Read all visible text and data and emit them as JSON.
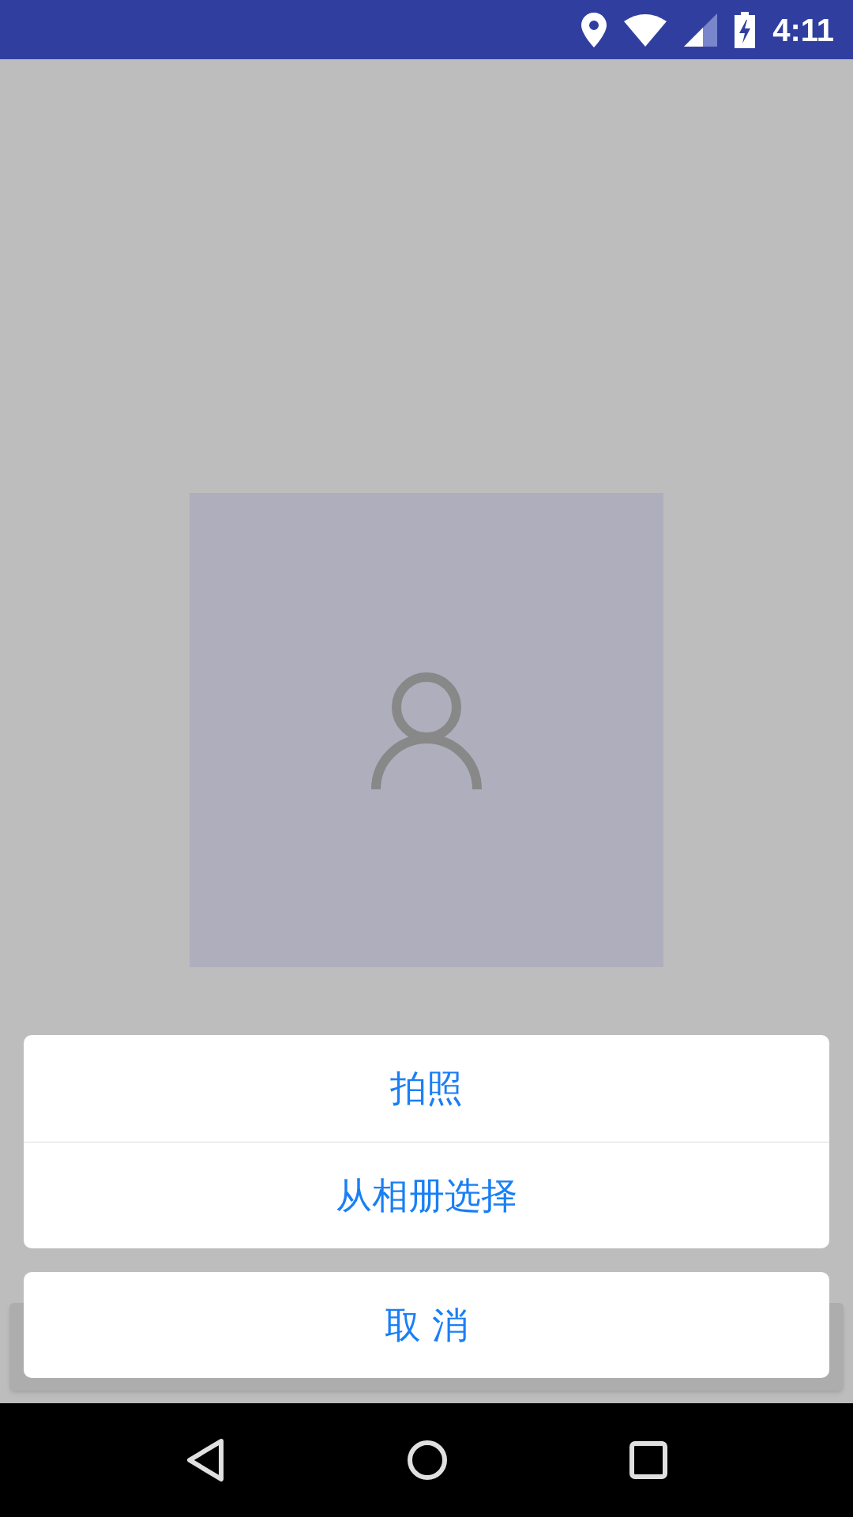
{
  "status_bar": {
    "time": "4:11"
  },
  "action_sheet": {
    "options": [
      {
        "label": "拍照"
      },
      {
        "label": "从相册选择"
      }
    ],
    "cancel": {
      "label": "取 消"
    }
  }
}
